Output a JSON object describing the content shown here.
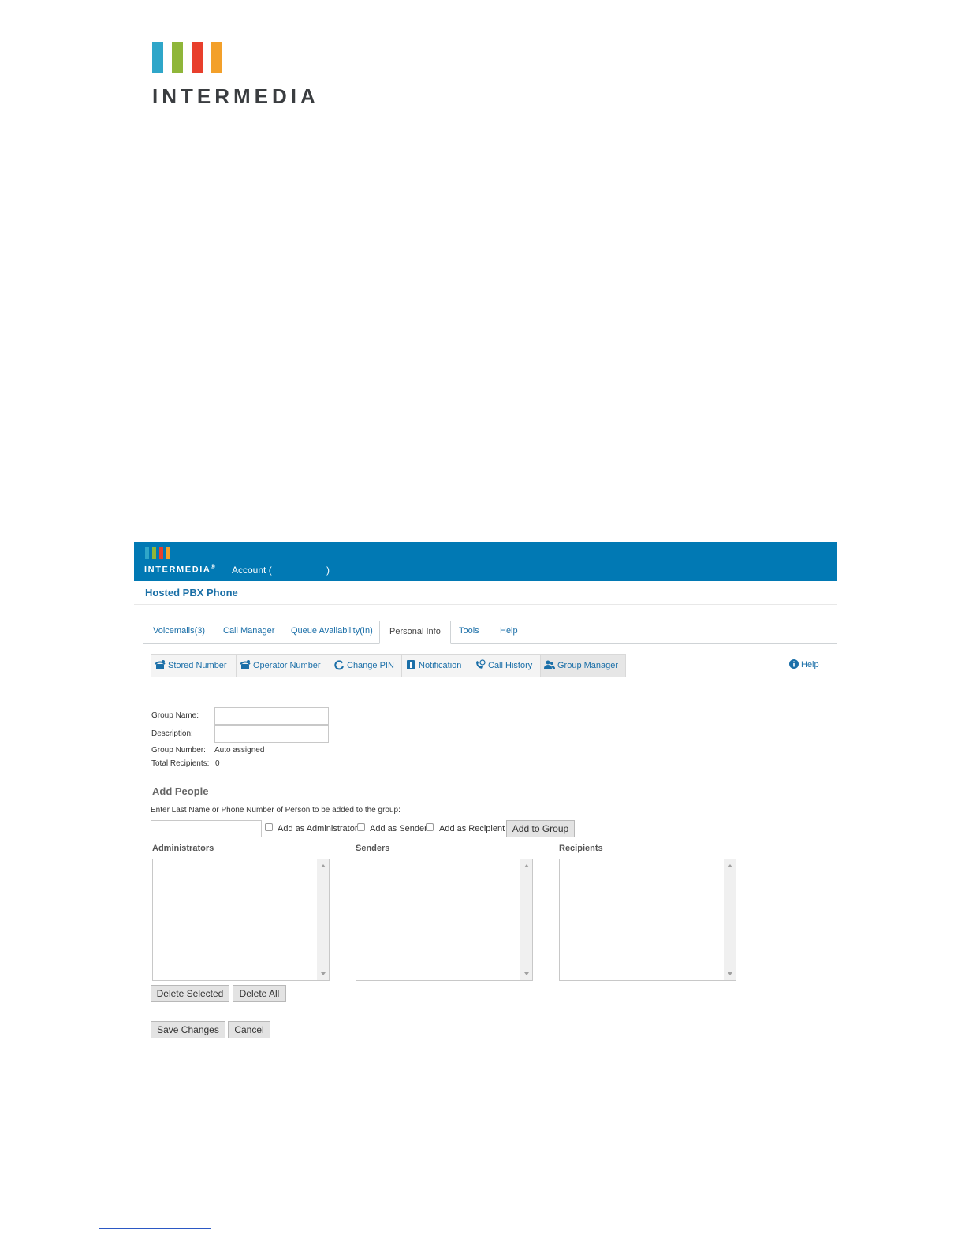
{
  "brand": {
    "name": "INTERMEDIA",
    "colors": [
      "#2fa6c9",
      "#8fb63a",
      "#e83f2c",
      "#f3a02a"
    ]
  },
  "header": {
    "brand": "INTERMEDIA",
    "brand_mark": "®",
    "account_label": "Account (",
    "account_close": ")"
  },
  "product_title": "Hosted PBX Phone",
  "tabs": [
    {
      "label": "Voicemails(3)"
    },
    {
      "label": "Call Manager"
    },
    {
      "label": "Queue Availability(In)"
    },
    {
      "label": "Personal Info"
    },
    {
      "label": "Tools"
    },
    {
      "label": "Help"
    }
  ],
  "subtabs": [
    {
      "label": "Stored Number",
      "icon": "phone-star-icon"
    },
    {
      "label": "Operator Number",
      "icon": "phone-star-icon"
    },
    {
      "label": "Change PIN",
      "icon": "refresh-icon"
    },
    {
      "label": "Notification",
      "icon": "alert-icon"
    },
    {
      "label": "Call History",
      "icon": "phone-history-icon"
    },
    {
      "label": "Group Manager",
      "icon": "users-icon"
    }
  ],
  "help_label": "Help",
  "form": {
    "group_name_label": "Group Name:",
    "group_name_value": "",
    "description_label": "Description:",
    "description_value": "",
    "group_number_label": "Group Number:",
    "group_number_value": "Auto assigned",
    "total_recipients_label": "Total Recipients:",
    "total_recipients_value": "0"
  },
  "add_people": {
    "heading": "Add People",
    "instruction": "Enter Last Name or Phone Number of Person to be added to the group:",
    "search_value": "",
    "add_admin_label": "Add as Administrator",
    "add_sender_label": "Add as Sender",
    "add_recipient_label": "Add as Recipient",
    "add_button": "Add to Group"
  },
  "lists": {
    "administrators": "Administrators",
    "senders": "Senders",
    "recipients": "Recipients"
  },
  "buttons": {
    "delete_selected": "Delete Selected",
    "delete_all": "Delete All",
    "save_changes": "Save Changes",
    "cancel": "Cancel"
  }
}
